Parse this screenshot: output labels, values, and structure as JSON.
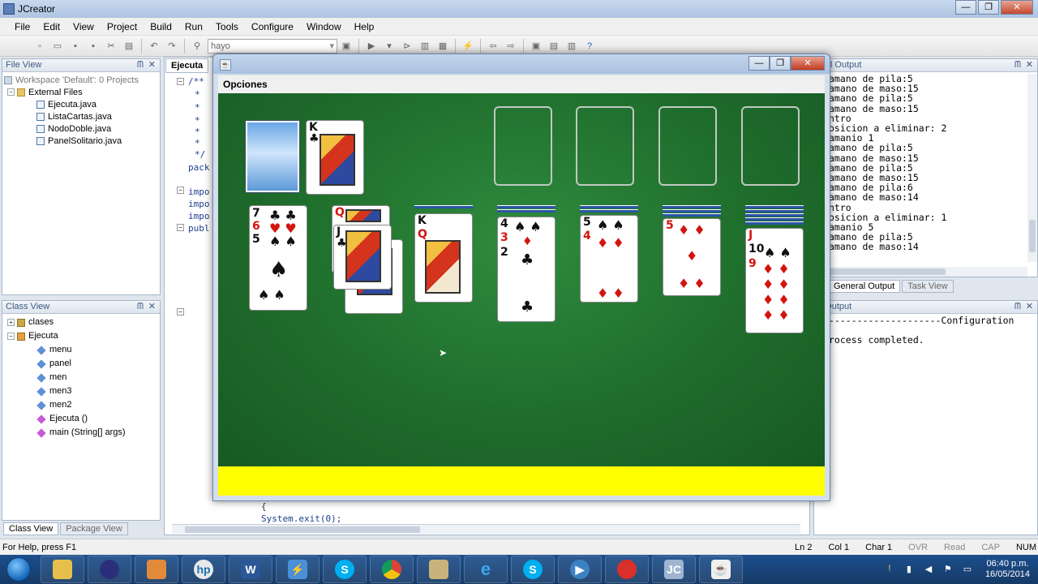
{
  "window": {
    "title": "JCreator"
  },
  "menu": [
    "File",
    "Edit",
    "View",
    "Project",
    "Build",
    "Run",
    "Tools",
    "Configure",
    "Window",
    "Help"
  ],
  "toolbar": {
    "search_value": "hayo"
  },
  "file_view": {
    "title": "File View",
    "workspace": "Workspace 'Default': 0 Projects",
    "folder": "External Files",
    "files": [
      "Ejecuta.java",
      "ListaCartas.java",
      "NodoDoble.java",
      "PanelSolitario.java"
    ]
  },
  "class_view": {
    "title": "Class View",
    "package": "clases",
    "class_name": "Ejecuta",
    "members": [
      "menu",
      "panel",
      "men",
      "men3",
      "men2",
      "Ejecuta ()",
      "main (String[] args)"
    ],
    "tabs": [
      "Class View",
      "Package View"
    ]
  },
  "editor": {
    "tab": "Ejecuta",
    "lines": [
      "/**",
      "*",
      "*",
      "*",
      "*",
      "*",
      "*/",
      "pack",
      "",
      "impo",
      "impo",
      "impo",
      "publ"
    ],
    "bottom_lines": [
      "{",
      "System.exit(0);"
    ]
  },
  "general_output": {
    "title": "eral Output",
    "lines": [
      "amano de pila:5",
      "amano de maso:15",
      "amano de pila:5",
      "amano de maso:15",
      "ntro",
      "osicion a eliminar: 2",
      "amanio 1",
      "amano de pila:5",
      "amano de maso:15",
      "amano de pila:5",
      "amano de maso:15",
      "amano de pila:6",
      "amano de maso:14",
      "ntro",
      "osicion a eliminar: 1",
      "amanio 5",
      "amano de pila:5",
      "amano de maso:14"
    ],
    "tabs": [
      "General Output",
      "Task View"
    ]
  },
  "build_output": {
    "title": "d Output",
    "line1": "--------------------Configuration",
    "line2": "rocess completed."
  },
  "status": {
    "help": "For Help, press F1",
    "ln": "Ln 2",
    "col": "Col 1",
    "char": "Char 1",
    "ovr": "OVR",
    "read": "Read",
    "cap": "CAP",
    "num": "NUM"
  },
  "game": {
    "menu_label": "Opciones",
    "waste_card": {
      "rank": "K",
      "suit": "♣"
    }
  },
  "taskbar": {
    "apps": [
      "explorer",
      "eclipse",
      "folder",
      "hp",
      "W",
      "flash",
      "S",
      "chrome",
      "archive",
      "ie",
      "S",
      "media",
      "recorder",
      "jc",
      "java"
    ],
    "time": "06:40 p.m.",
    "date": "16/05/2014"
  }
}
